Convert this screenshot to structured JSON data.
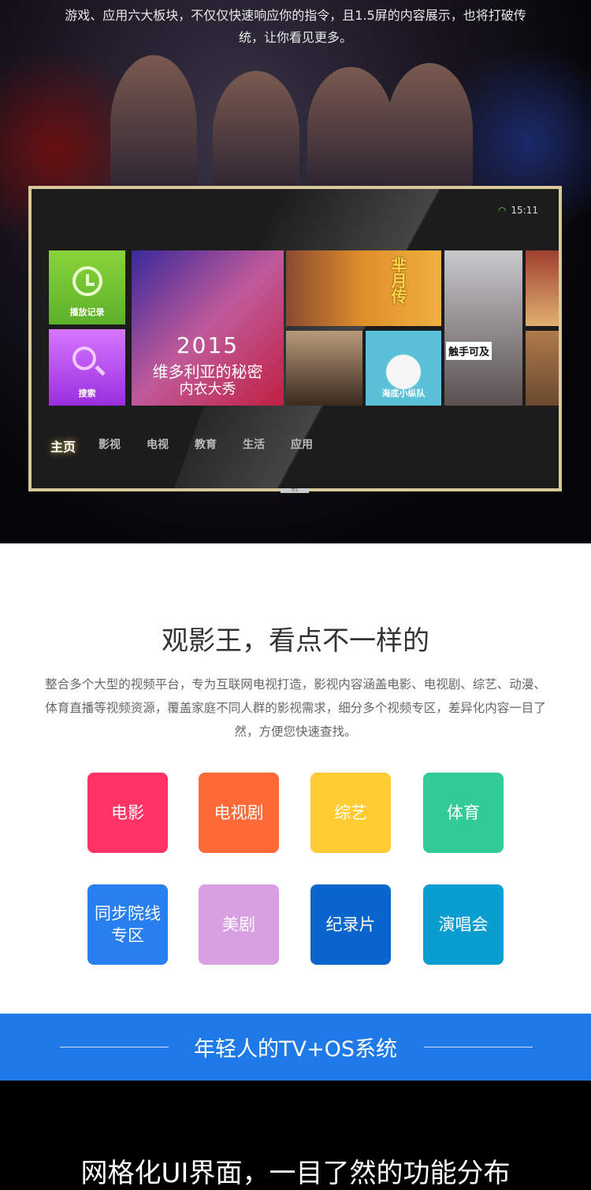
{
  "hero": {
    "intro_lines": [
      "游戏、应用六大板块，不仅仅快速响应你的指令，且1.5屏的内容展示，也将打破传",
      "统，让你看见更多。"
    ]
  },
  "tv": {
    "time": "15:11",
    "wifi_icon": "wifi-icon",
    "tiles": {
      "history": "播放记录",
      "search": "搜索",
      "poster_year": "2015",
      "poster_title1": "维多利亚的秘密",
      "poster_title2": "内衣大秀",
      "drama": "芈月传",
      "cartoon": "海底小纵队",
      "doc": "触手可及"
    },
    "nav": [
      "主页",
      "影视",
      "电视",
      "教育",
      "生活",
      "应用"
    ],
    "brand": "TCL"
  },
  "section": {
    "title": "观影王，看点不一样的",
    "desc": "整合多个大型的视频平台，专为互联网电视打造，影视内容涵盖电影、电视剧、综艺、动漫、体育直播等视频资源，覆盖家庭不同人群的影视需求，细分多个视频专区，差异化内容一目了然，方便您快速查找。",
    "categories": [
      {
        "label": "电影",
        "color": "#ff3366"
      },
      {
        "label": "电视剧",
        "color": "#ff6a36"
      },
      {
        "label": "综艺",
        "color": "#ffcc33"
      },
      {
        "label": "体育",
        "color": "#33cc99"
      },
      {
        "label": "同步院线专区",
        "color": "#2a7ff0"
      },
      {
        "label": "美剧",
        "color": "#d99fe3"
      },
      {
        "label": "纪录片",
        "color": "#0a66cc"
      },
      {
        "label": "演唱会",
        "color": "#0a9dcf"
      }
    ]
  },
  "banner": {
    "title": "年轻人的TV+OS系统",
    "color": "#1f7ae8"
  },
  "bottom": {
    "title": "网格化UI界面，一目了然的功能分布"
  }
}
